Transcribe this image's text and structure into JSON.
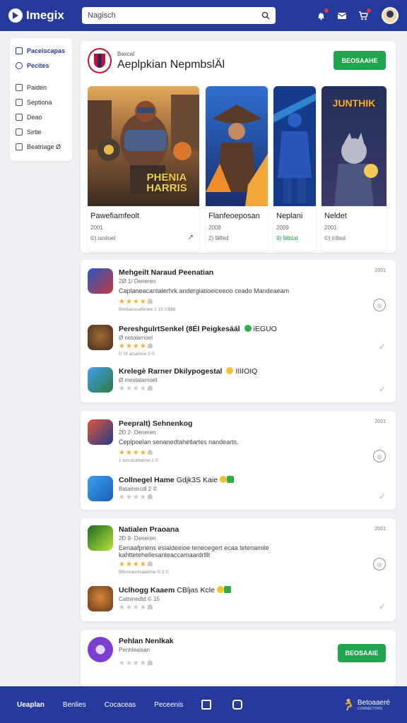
{
  "header": {
    "logo_text": "Imegix",
    "search_value": "Nagisch",
    "icons": [
      "search-icon",
      "bell-icon",
      "mail-icon",
      "cart-icon",
      "avatar"
    ]
  },
  "sidebar": {
    "items": [
      {
        "label": "Paceiscapas",
        "icon": "grid-icon",
        "active": true
      },
      {
        "label": "Pecites",
        "icon": "discover-icon",
        "active": true
      },
      {
        "label": "Paiden",
        "icon": "list-icon"
      },
      {
        "label": "Septiona",
        "icon": "doc-icon"
      },
      {
        "label": "Deao",
        "icon": "doc-icon"
      },
      {
        "label": "Sirtie",
        "icon": "image-icon"
      },
      {
        "label": "Beatriage Ø",
        "icon": "calendar-icon"
      }
    ]
  },
  "hero": {
    "kicker": "Baxcal",
    "title": "Aeplpkian NepmbslÄl",
    "button": "BEOSAAHE",
    "games": [
      {
        "title": "Pawefiamfeolt",
        "year": "2001",
        "meta": "©) isniloel",
        "art_text": "PHENIA HARRIS"
      },
      {
        "title": "Flanfeoeposan",
        "year": "2008",
        "meta": "2) 9ilfed"
      },
      {
        "title": "Neplani",
        "year": "2009",
        "meta": "9) 9ilbtat",
        "ok": true
      },
      {
        "title": "Neldet",
        "year": "2001",
        "meta": "©) irilted",
        "art_text": "JUNTHIK"
      }
    ]
  },
  "list1": {
    "time": "2001",
    "rows": [
      {
        "title": "Mehgeilt Naraud Peenatian",
        "sub": "2Ø 1/ Deneren",
        "desc": "Caplaneacantalerhrk andergiatioeiceeoo ceado Mandeaeam",
        "rating": 4,
        "note": "Bimbarscalfenee 2 15 ©$$8"
      },
      {
        "title": "PereshgulrtSenkel (8Él Peigkesáál",
        "tag": "iEGUO",
        "note": "Ø netolarnoel",
        "rating": 4,
        "sub2": "© Sf alsamoe 3 ©"
      },
      {
        "title": "Krelegè Rarner Dkilypogestal",
        "tag": "IIIIOIQ",
        "note": "Ø mestalarnoel",
        "rating": 0
      }
    ]
  },
  "list2": {
    "time": "2001",
    "rows": [
      {
        "title": "Peepralt) Sehnenkog",
        "sub": "2Ð 2- Deneren",
        "desc": "Ceplpoelan senanedtahetlartes nandearts.",
        "rating": 4,
        "note": "1 tenrasidtelme 2 ©"
      },
      {
        "title": "Collnegel Hame",
        "tag": "Gdjk3S Kaie",
        "note": "Batainsrcdl 2 ©",
        "rating": 0
      }
    ]
  },
  "list3": {
    "time": "2001",
    "rows": [
      {
        "title": "Natialen Praoana",
        "sub": "2Ð 9- Deneren",
        "desc": "Eenaafpriens eslaldeeioe teneoegert ecaa tetenamile",
        "desc2": "kahttetehellesanteaccamaardrlllt",
        "rating": 4,
        "note": "Bihrnrasntsatelme © 2 ©"
      },
      {
        "title": "Uclhogg Kaaem",
        "tag": "CBljas Kcle",
        "note": "Catninedtd © 15",
        "rating": 0
      }
    ]
  },
  "list4": {
    "title": "Pehlan Nenlkak",
    "sub": "Penhleaisan",
    "button": "BEOSAAIE",
    "rating": 0
  },
  "bottom": {
    "items": [
      {
        "label": "Ueaplan",
        "active": true
      },
      {
        "label": "Benlies"
      },
      {
        "label": "Cocaceas"
      },
      {
        "label": "Peceenis"
      }
    ],
    "right_label": "Betoaaerè",
    "right_sub": "CONNECTORS"
  }
}
